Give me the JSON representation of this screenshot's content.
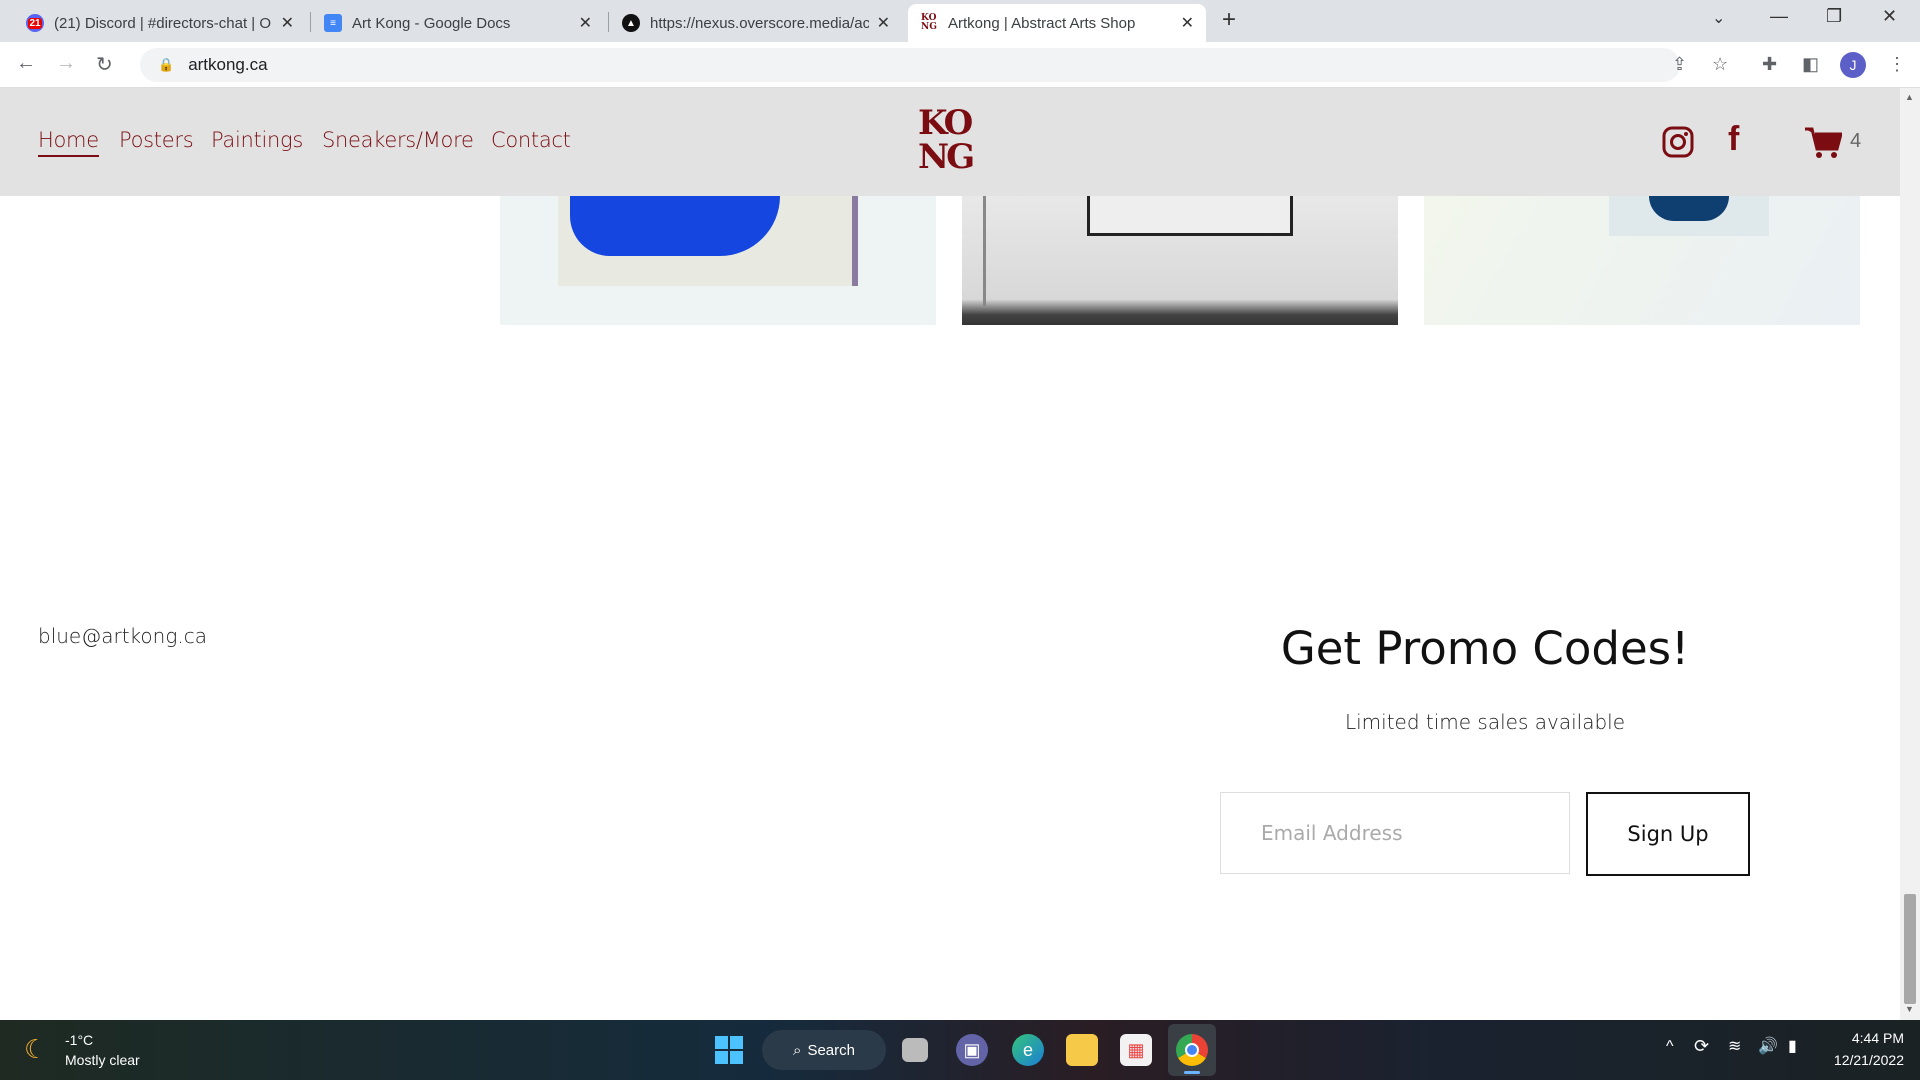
{
  "browser": {
    "tabs": [
      {
        "title": "(21) Discord | #directors-chat | O",
        "badge": "21",
        "icon": "discord-icon"
      },
      {
        "title": "Art Kong - Google Docs",
        "icon": "google-docs-icon"
      },
      {
        "title": "https://nexus.overscore.media/ac",
        "icon": "overscore-icon"
      },
      {
        "title": "Artkong | Abstract Arts Shop",
        "icon": "kong-logo-icon",
        "active": true
      }
    ],
    "new_tab": "+",
    "url": "artkong.ca",
    "profile_initial": "J"
  },
  "site": {
    "nav": [
      "Home",
      "Posters",
      "Paintings",
      "Sneakers/More",
      "Contact"
    ],
    "active_nav": "Home",
    "logo": [
      "KO",
      "NG"
    ],
    "cart_count": "4",
    "brand_color": "#7b0d12",
    "header_bg": "#e2e2e2",
    "contact_email": "blue@artkong.ca",
    "promo": {
      "title": "Get Promo Codes!",
      "subtitle": "Limited time sales available",
      "email_placeholder": "Email Address",
      "button": "Sign Up"
    }
  },
  "taskbar": {
    "weather_temp": "-1°C",
    "weather_desc": "Mostly clear",
    "search": "Search",
    "time": "4:44 PM",
    "date": "12/21/2022"
  }
}
